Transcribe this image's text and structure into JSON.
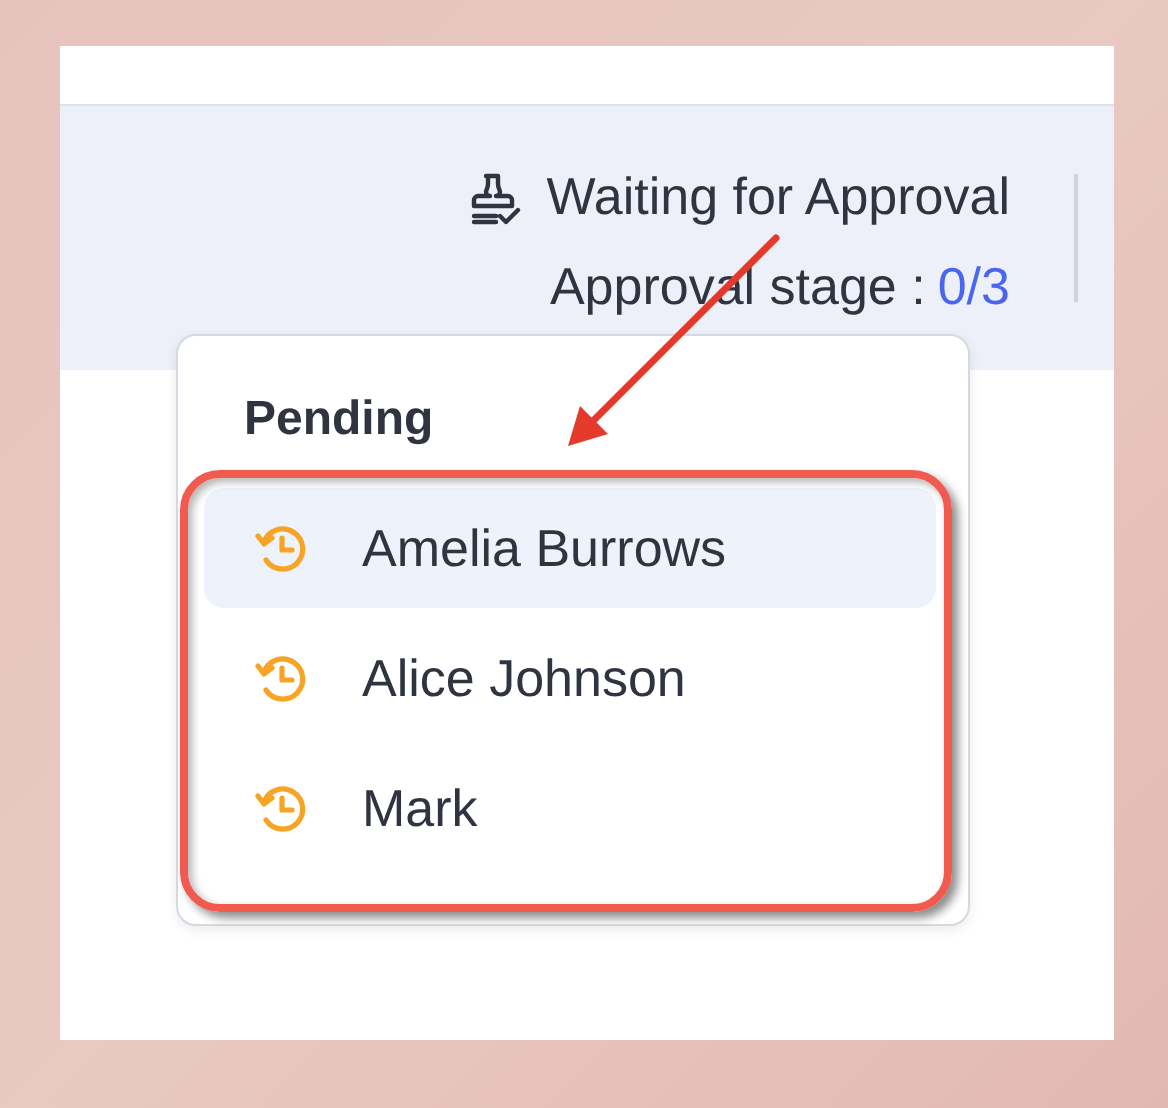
{
  "status": {
    "title": "Waiting for Approval",
    "stage_label": "Approval stage :",
    "stage_value": "0/3"
  },
  "popup": {
    "heading": "Pending",
    "approvers": [
      {
        "name": "Amelia Burrows",
        "selected": true
      },
      {
        "name": "Alice Johnson",
        "selected": false
      },
      {
        "name": "Mark",
        "selected": false
      }
    ]
  }
}
